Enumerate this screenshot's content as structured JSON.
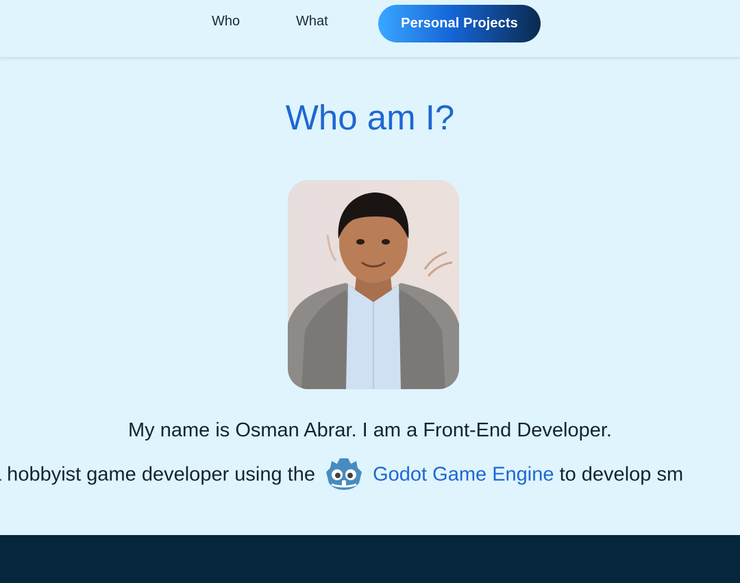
{
  "nav": {
    "who_label": "Who",
    "what_label": "What",
    "projects_label": "Personal Projects"
  },
  "main": {
    "title": "Who am I?",
    "avatar_icon": "person-photo-icon",
    "intro_text": "My name is Osman Abrar. I am a Front-End Developer.",
    "hobby_prefix": "a hobbyist game developer using the",
    "godot_icon": "godot-logo-icon",
    "godot_link_label": "Godot Game Engine",
    "hobby_suffix": "to develop sm"
  },
  "colors": {
    "background": "#dff4fc",
    "accent": "#1e67d3",
    "footer": "#06273b",
    "button_gradient_start": "#3aa7ff",
    "button_gradient_end": "#0b2a4e"
  }
}
